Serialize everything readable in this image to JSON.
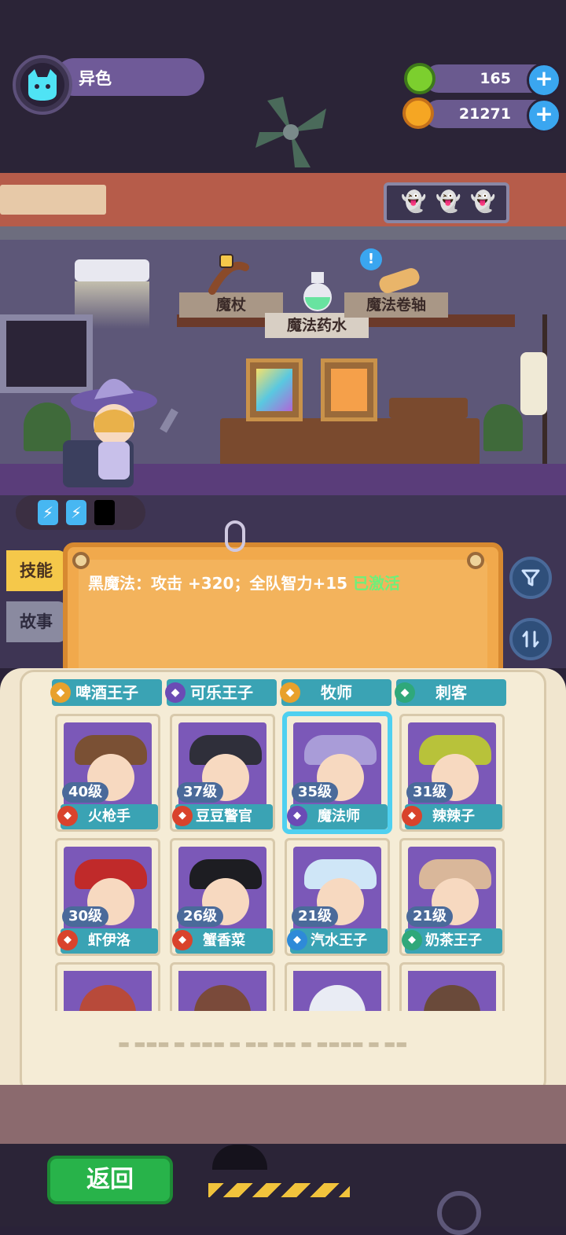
{
  "profile": {
    "name": "异色",
    "avatar_icon": "cat-face-icon"
  },
  "resources": [
    {
      "icon": "green-gem-icon",
      "value": "165"
    },
    {
      "icon": "orange-planet-coin-icon",
      "value": "21271"
    }
  ],
  "room": {
    "shelf_labels": [
      "魔杖",
      "魔法药水",
      "魔法卷轴"
    ],
    "energy_count": 2
  },
  "side_tabs": {
    "skill": "技能",
    "story": "故事"
  },
  "skill_card": {
    "text": "黑魔法：攻击 +320；全队智力+15",
    "status": "已激活"
  },
  "class_tabs": [
    {
      "label": "啤酒王子",
      "badge_color": "#e8a12c"
    },
    {
      "label": "可乐王子",
      "badge_color": "#6b4bb5"
    },
    {
      "label": "牧师",
      "badge_color": "#e8a12c"
    },
    {
      "label": "刺客",
      "badge_color": "#2fa87a"
    }
  ],
  "heroes": [
    {
      "name": "火枪手",
      "level": "40级",
      "faction_color": "#d9432c",
      "hat_color": "#7a5034"
    },
    {
      "name": "豆豆警官",
      "level": "37级",
      "faction_color": "#d9432c",
      "hat_color": "#2f2f3a"
    },
    {
      "name": "魔法师",
      "level": "35级",
      "faction_color": "#6b4bb5",
      "hat_color": "#a99cd8",
      "selected": true
    },
    {
      "name": "辣辣子",
      "level": "31级",
      "faction_color": "#d9432c",
      "hat_color": "#b8c23a"
    },
    {
      "name": "虾伊洛",
      "level": "30级",
      "faction_color": "#d9432c",
      "hat_color": "#c02a2a"
    },
    {
      "name": "蟹香菜",
      "level": "26级",
      "faction_color": "#d9432c",
      "hat_color": "#1d1d22"
    },
    {
      "name": "汽水王子",
      "level": "21级",
      "faction_color": "#2e8ad8",
      "hat_color": "#cfe6f7"
    },
    {
      "name": "奶茶王子",
      "level": "21级",
      "faction_color": "#2fa87a",
      "hat_color": "#d9b79a"
    }
  ],
  "partial_heroes": [
    {
      "hat_color": "#b84a3a"
    },
    {
      "hat_color": "#7a4a3a"
    },
    {
      "hat_color": "#e9ecf4"
    },
    {
      "hat_color": "#6a4a3a"
    }
  ],
  "back_label": "返回"
}
